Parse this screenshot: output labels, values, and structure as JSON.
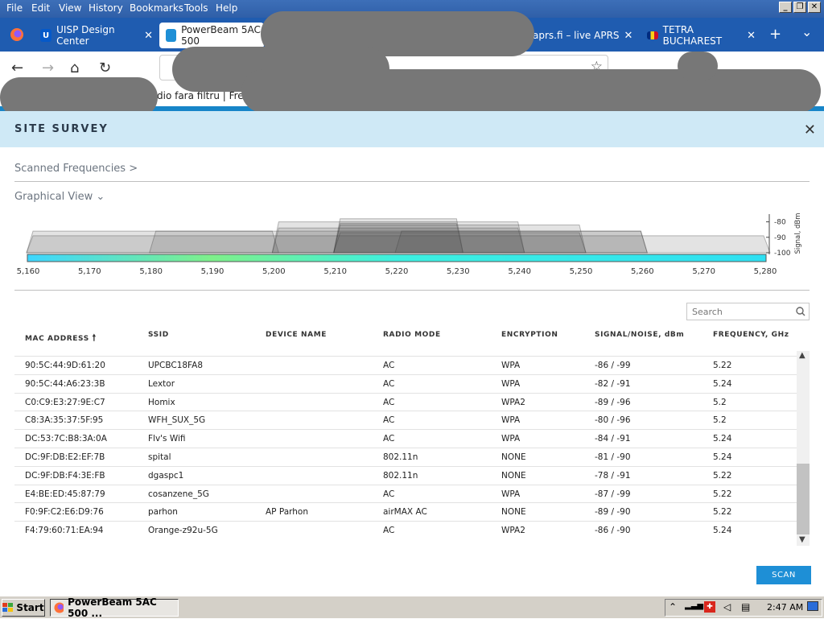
{
  "menubar": {
    "items": [
      "File",
      "Edit",
      "View",
      "History",
      "Bookmarks",
      "Tools",
      "Help"
    ],
    "window_buttons": [
      "_",
      "❐",
      "✕"
    ]
  },
  "tabs": [
    {
      "label": "UISP Design Center",
      "close": "✕"
    },
    {
      "label": "PowerBeam 5AC 500",
      "close": ""
    },
    {
      "label": "aprs.fi – live APRS",
      "close": "✕"
    },
    {
      "label": "TETRA BUCHAREST",
      "close": "✕"
    }
  ],
  "tabbar": {
    "new_tab": "+",
    "list_all": "⌄"
  },
  "nav": {
    "back": "←",
    "forward": "→",
    "home": "⌂",
    "reload": "↻",
    "star": "☆"
  },
  "bookmarks": {
    "visible_item": "dio fara filtru | Fre..."
  },
  "survey": {
    "title": "SITE SURVEY",
    "close": "✕",
    "scanned_frequencies": "Scanned Frequencies",
    "scanned_chevron": ">",
    "graphical_view": "Graphical View",
    "graphical_chevron": "⌄",
    "search_placeholder": "Search",
    "scan_button": "SCAN"
  },
  "chart_data": {
    "type": "area",
    "x_ticks": [
      "5,160",
      "5,170",
      "5,180",
      "5,190",
      "5,200",
      "5,210",
      "5,220",
      "5,230",
      "5,240",
      "5,250",
      "5,260",
      "5,270",
      "5,280"
    ],
    "y_ticks": [
      "-80",
      "-90",
      "-100"
    ],
    "ylabel": "Signal, dBm",
    "xlim": [
      5160,
      5280
    ],
    "ylim": [
      -100,
      -75
    ],
    "series": [
      {
        "x_start": 5160,
        "x_end": 5280,
        "y": -89
      },
      {
        "x_start": 5160,
        "x_end": 5200,
        "y": -86
      },
      {
        "x_start": 5180,
        "x_end": 5260,
        "y": -86
      },
      {
        "x_start": 5200,
        "x_end": 5240,
        "y": -84
      },
      {
        "x_start": 5200,
        "x_end": 5240,
        "y": -80
      },
      {
        "x_start": 5210,
        "x_end": 5230,
        "y": -81
      },
      {
        "x_start": 5210,
        "x_end": 5230,
        "y": -78
      },
      {
        "x_start": 5210,
        "x_end": 5250,
        "y": -82
      },
      {
        "x_start": 5220,
        "x_end": 5260,
        "y": -86
      },
      {
        "x_start": 5210,
        "x_end": 5250,
        "y": -87
      }
    ]
  },
  "table": {
    "columns": [
      "MAC ADDRESS",
      "SSID",
      "DEVICE NAME",
      "RADIO MODE",
      "ENCRYPTION",
      "SIGNAL/NOISE, dBm",
      "FREQUENCY, GHz"
    ],
    "sort_indicator": "🠕",
    "rows": [
      [
        "90:5C:44:9D:61:20",
        "UPCBC18FA8",
        "",
        "AC",
        "WPA",
        "-86 / -99",
        "5.22"
      ],
      [
        "90:5C:44:A6:23:3B",
        "Lextor",
        "",
        "AC",
        "WPA",
        "-82 / -91",
        "5.24"
      ],
      [
        "C0:C9:E3:27:9E:C7",
        "Homix",
        "",
        "AC",
        "WPA2",
        "-89 / -96",
        "5.2"
      ],
      [
        "C8:3A:35:37:5F:95",
        "WFH_SUX_5G",
        "",
        "AC",
        "WPA",
        "-80 / -96",
        "5.2"
      ],
      [
        "DC:53:7C:B8:3A:0A",
        "Flv's Wifi",
        "",
        "AC",
        "WPA",
        "-84 / -91",
        "5.24"
      ],
      [
        "DC:9F:DB:E2:EF:7B",
        "spital",
        "",
        "802.11n",
        "NONE",
        "-81 / -90",
        "5.24"
      ],
      [
        "DC:9F:DB:F4:3E:FB",
        "dgaspc1",
        "",
        "802.11n",
        "NONE",
        "-78 / -91",
        "5.22"
      ],
      [
        "E4:BE:ED:45:87:79",
        "cosanzene_5G",
        "",
        "AC",
        "WPA",
        "-87 / -99",
        "5.22"
      ],
      [
        "F0:9F:C2:E6:D9:76",
        "parhon",
        "AP Parhon",
        "airMAX AC",
        "NONE",
        "-89 / -90",
        "5.22"
      ],
      [
        "F4:79:60:71:EA:94",
        "Orange-z92u-5G",
        "",
        "AC",
        "WPA2",
        "-86 / -90",
        "5.24"
      ]
    ]
  },
  "taskbar": {
    "start": "Start",
    "task": "PowerBeam 5AC 500 ...",
    "clock": "2:47 AM"
  },
  "colors": {
    "header_bg": "#cfe9f6",
    "accent": "#1e8fd6",
    "tab_bar": "#1f5cb0"
  }
}
